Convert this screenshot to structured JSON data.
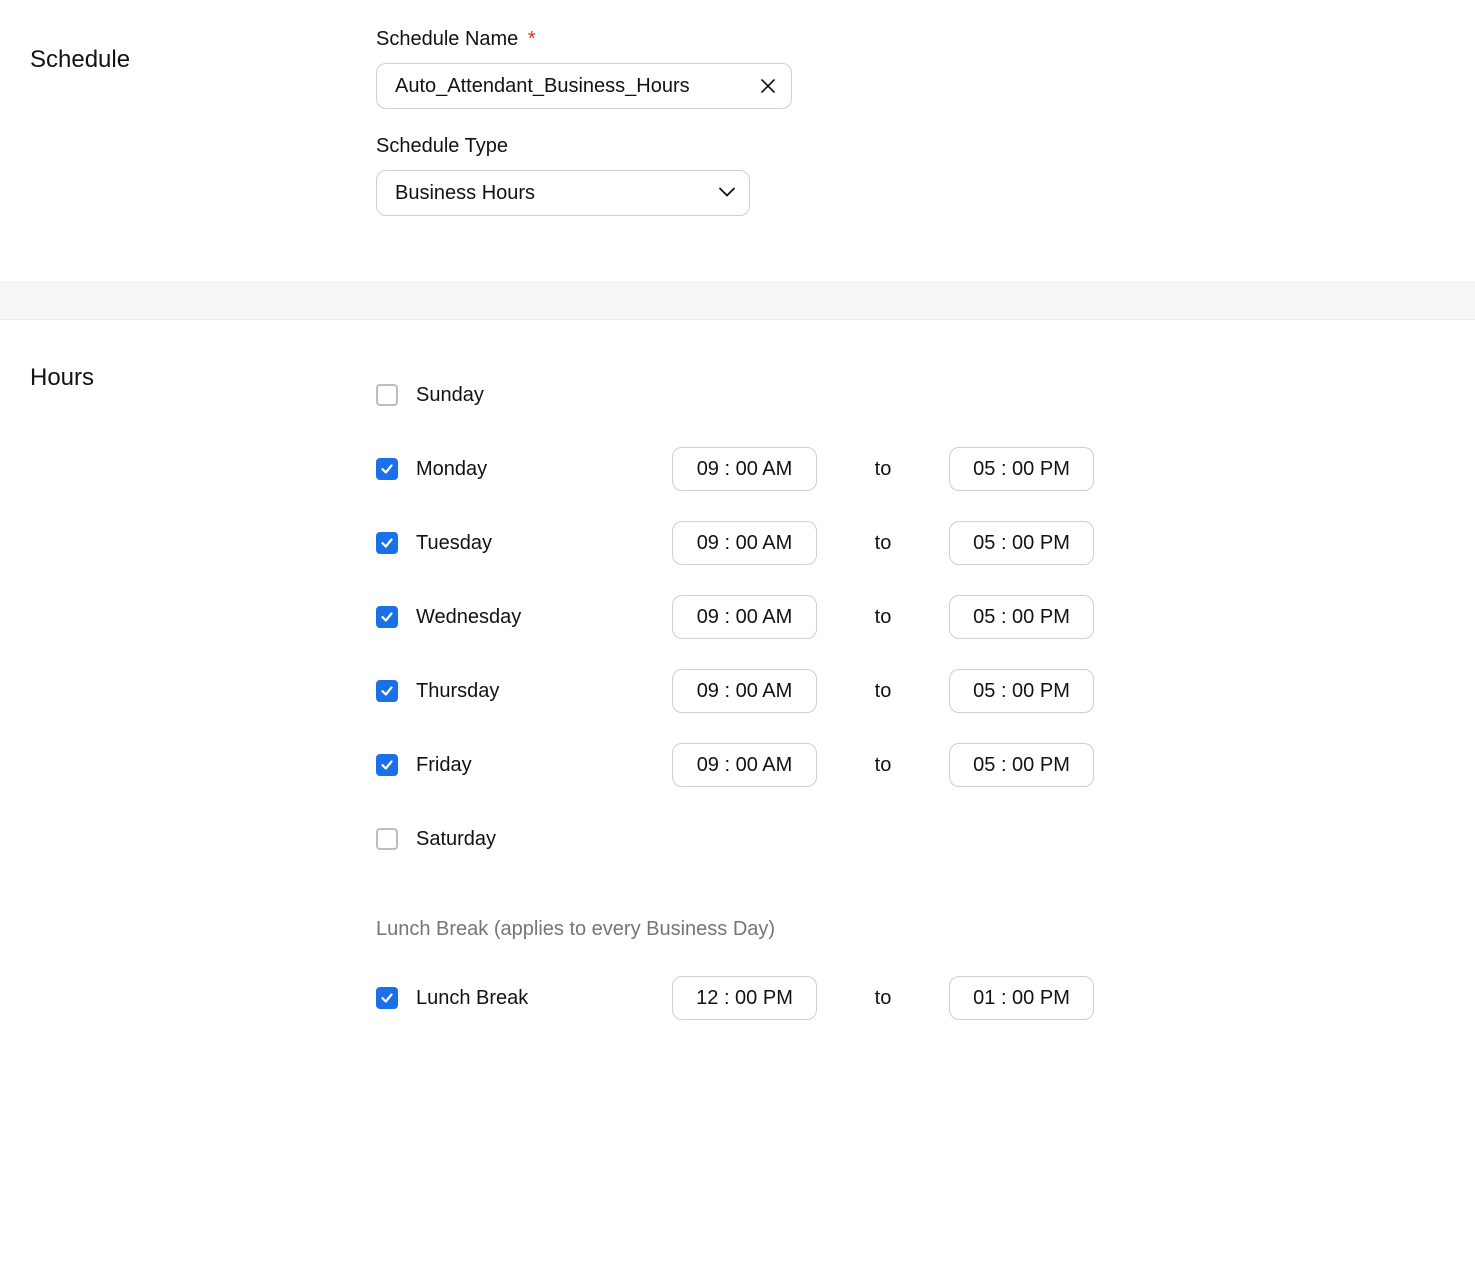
{
  "headings": {
    "schedule": "Schedule",
    "hours": "Hours"
  },
  "schedule_name": {
    "label": "Schedule Name",
    "required_marker": "*",
    "value": "Auto_Attendant_Business_Hours"
  },
  "schedule_type": {
    "label": "Schedule Type",
    "value": "Business Hours"
  },
  "to_label": "to",
  "days": [
    {
      "name": "Sunday",
      "checked": false,
      "start": "",
      "end": ""
    },
    {
      "name": "Monday",
      "checked": true,
      "start": "09 : 00 AM",
      "end": "05 : 00 PM"
    },
    {
      "name": "Tuesday",
      "checked": true,
      "start": "09 : 00 AM",
      "end": "05 : 00 PM"
    },
    {
      "name": "Wednesday",
      "checked": true,
      "start": "09 : 00 AM",
      "end": "05 : 00 PM"
    },
    {
      "name": "Thursday",
      "checked": true,
      "start": "09 : 00 AM",
      "end": "05 : 00 PM"
    },
    {
      "name": "Friday",
      "checked": true,
      "start": "09 : 00 AM",
      "end": "05 : 00 PM"
    },
    {
      "name": "Saturday",
      "checked": false,
      "start": "",
      "end": ""
    }
  ],
  "lunch": {
    "note": "Lunch Break (applies to every Business Day)",
    "label": "Lunch Break",
    "checked": true,
    "start": "12 : 00 PM",
    "end": "01 : 00 PM"
  }
}
